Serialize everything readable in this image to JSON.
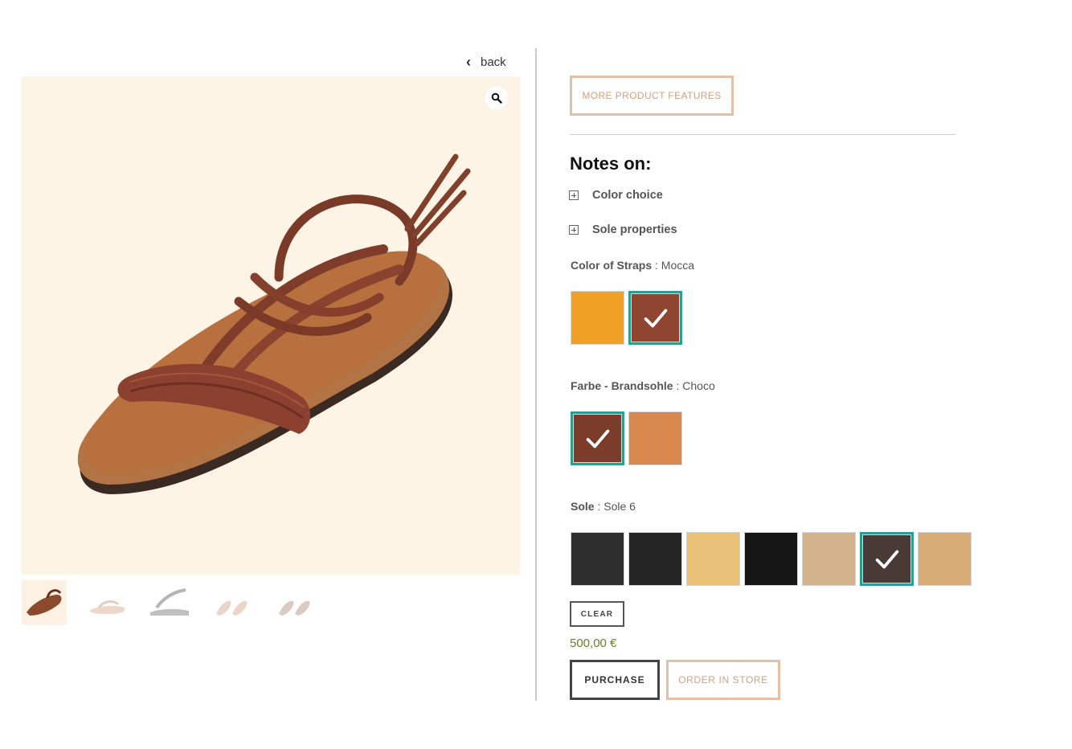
{
  "nav": {
    "back_label": "back"
  },
  "gallery": {
    "zoom_icon": "magnifier-icon",
    "thumbnail_count": 5
  },
  "actions": {
    "more_features_label": "MORE PRODUCT FEATURES",
    "clear_label": "CLEAR",
    "purchase_label": "PURCHASE",
    "order_in_store_label": "ORDER IN STORE"
  },
  "notes": {
    "title": "Notes on:",
    "items": [
      {
        "label": "Color choice"
      },
      {
        "label": "Sole properties"
      }
    ]
  },
  "options": {
    "straps": {
      "label": "Color of Straps",
      "separator": " : ",
      "value": "Mocca",
      "swatches": [
        {
          "name": "orange",
          "color": "#f0a024",
          "selected": false
        },
        {
          "name": "mocca",
          "color": "#8f4530",
          "selected": true
        }
      ]
    },
    "insole": {
      "label": "Farbe - Brandsohle",
      "separator": " : ",
      "value": "Choco",
      "swatches": [
        {
          "name": "choco",
          "color": "#7b3c2c",
          "selected": true
        },
        {
          "name": "tan",
          "color": "#d8874d",
          "selected": false
        }
      ]
    },
    "sole": {
      "label": "Sole",
      "separator": " : ",
      "value": "Sole 6",
      "swatches": [
        {
          "name": "sole-1",
          "color": "#2e2e2e",
          "selected": false
        },
        {
          "name": "sole-2",
          "color": "#252525",
          "selected": false
        },
        {
          "name": "sole-3",
          "color": "#e7c277",
          "selected": false
        },
        {
          "name": "sole-4",
          "color": "#151515",
          "selected": false
        },
        {
          "name": "sole-5",
          "color": "#d3b28e",
          "selected": false
        },
        {
          "name": "sole-6",
          "color": "#4a3a35",
          "selected": true
        },
        {
          "name": "sole-7",
          "color": "#d8ac77",
          "selected": false
        }
      ]
    }
  },
  "price": "500,00 €",
  "colors": {
    "accent_border": "#e4c1a6",
    "accent_text": "#d3a07e",
    "selected_border": "#2a9d94",
    "price_text": "#6e7b2c",
    "hero_background": "#fdf4e5"
  }
}
